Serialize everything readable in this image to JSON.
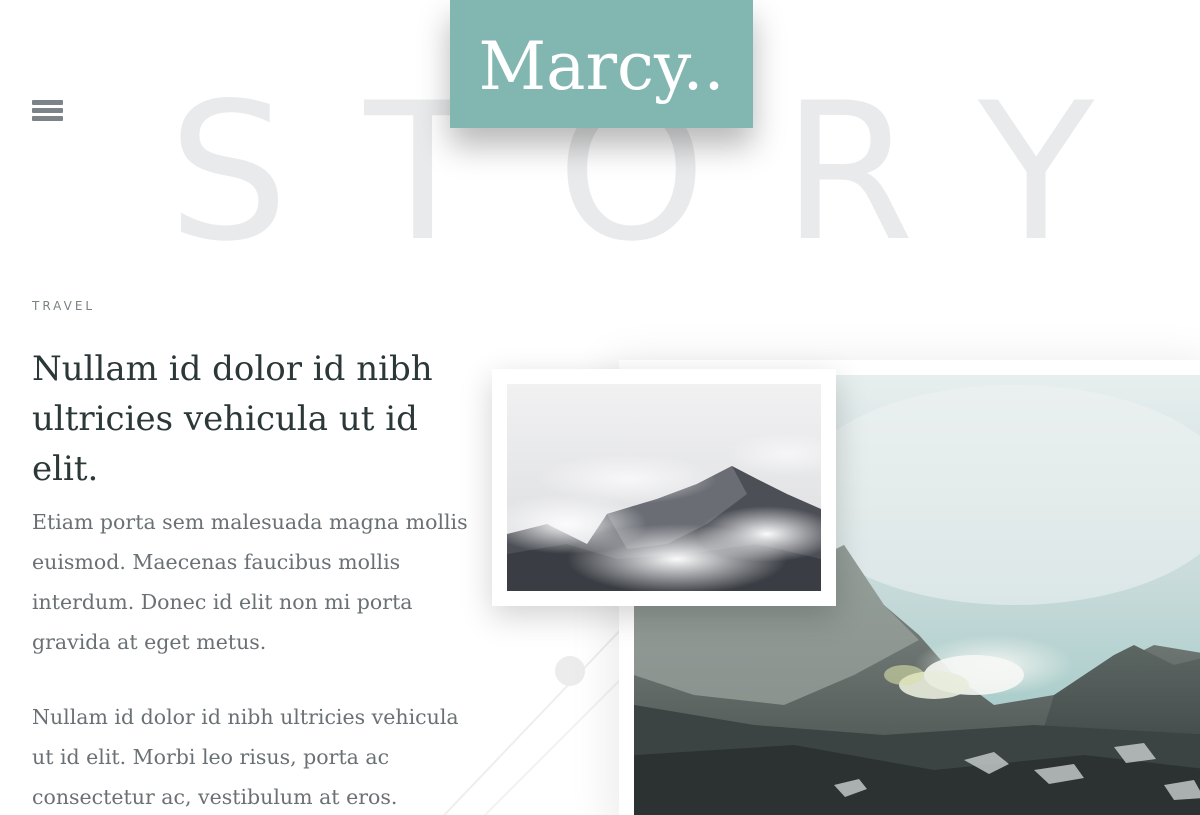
{
  "brand": {
    "logo_text": "Marcy..",
    "accent_color": "#82b6b1"
  },
  "hero": {
    "watermark": "STORY"
  },
  "nav": {
    "menu_icon": "hamburger-icon"
  },
  "article": {
    "category": "TRAVEL",
    "title": "Nullam id dolor id nibh ultricies vehicula ut id elit.",
    "paragraphs": [
      "Etiam porta sem malesuada magna mollis euismod. Maecenas faucibus mollis interdum. Donec id elit non mi porta gravida at eget metus.",
      "Nullam id dolor id nibh ultricies vehicula ut id elit. Morbi leo risus, porta ac consectetur ac, vestibulum at eros."
    ]
  }
}
